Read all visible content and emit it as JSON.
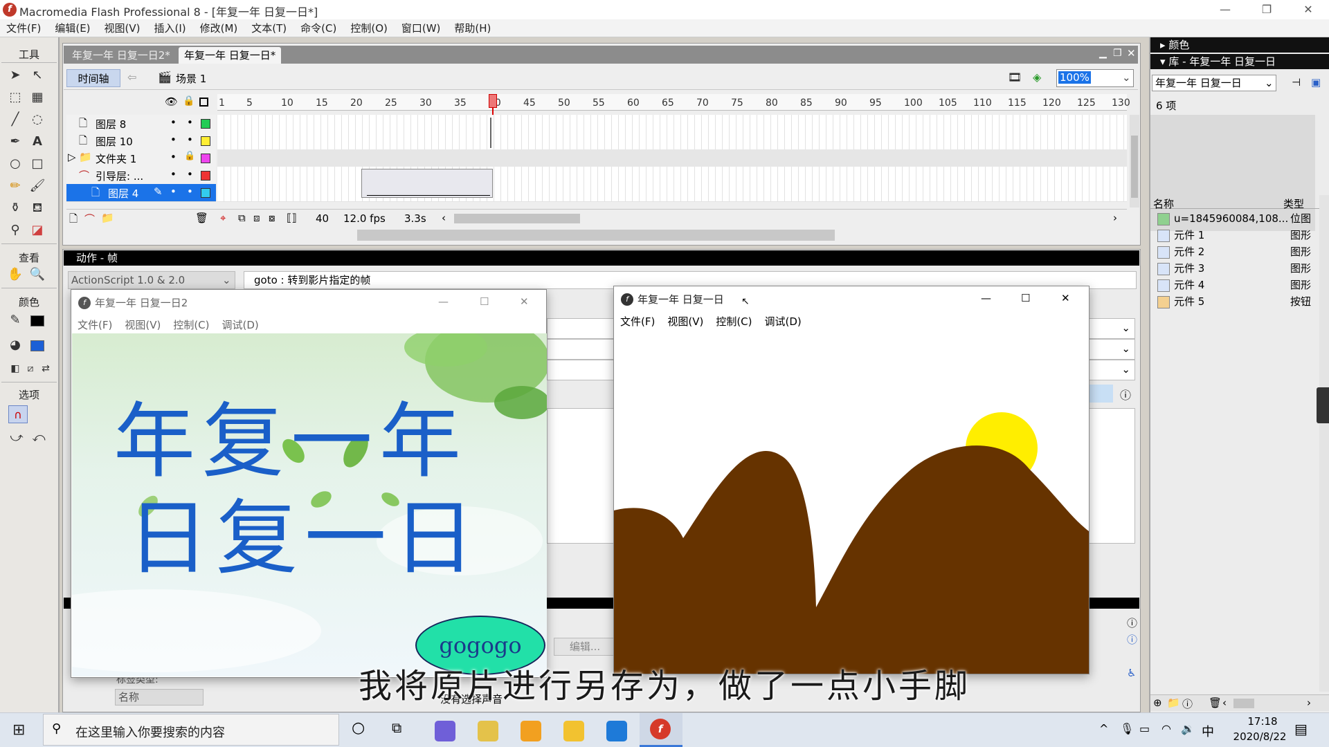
{
  "app": {
    "title": "Macromedia Flash Professional 8 - [年复一年  日复一日*]",
    "window_controls": {
      "minimize": "—",
      "maximize": "❐",
      "close": "✕"
    }
  },
  "menubar": [
    "文件(F)",
    "编辑(E)",
    "视图(V)",
    "插入(I)",
    "修改(M)",
    "文本(T)",
    "命令(C)",
    "控制(O)",
    "窗口(W)",
    "帮助(H)"
  ],
  "tools": {
    "header": "工具",
    "view_header": "查看",
    "color_header": "颜色",
    "options_header": "选项"
  },
  "doc_tabs": [
    "年复一年  日复一日2*",
    "年复一年  日复一日*"
  ],
  "timeline": {
    "button": "时间轴",
    "scene": "场景 1",
    "zoom": "100%",
    "ruler_ticks": [
      "1",
      "5",
      "10",
      "15",
      "20",
      "25",
      "30",
      "35",
      "40",
      "45",
      "50",
      "55",
      "60",
      "65",
      "70",
      "75",
      "80",
      "85",
      "90",
      "95",
      "100",
      "105",
      "110",
      "115",
      "120",
      "125",
      "130"
    ],
    "layers": [
      {
        "name": "图层 8",
        "color": "#22cc55"
      },
      {
        "name": "图层 10",
        "color": "#ffee33"
      },
      {
        "name": "文件夹 1",
        "color": "#ee44ee"
      },
      {
        "name": "引导层: ...",
        "color": "#ee3333"
      },
      {
        "name": "图层 4",
        "color": "#33ccee"
      }
    ],
    "current_frame": "40",
    "fps": "12.0 fps",
    "time": "3.3s"
  },
  "actions": {
    "header": "动作 - 帧",
    "version_select": "ActionScript 1.0 & 2.0",
    "hint": "goto : 转到影片指定的帧",
    "edit_button": "编辑...",
    "no_sound": "没有选择声音",
    "sound_type_label": "标签类型:",
    "sound_name_select": "名称"
  },
  "library": {
    "color_header": "颜色",
    "header": "库 - 年复一年  日复一日",
    "doc_select": "年复一年  日复一日",
    "count": "6 项",
    "col_name": "名称",
    "col_type": "类型",
    "items": [
      {
        "name": "u=1845960084,108...",
        "type": "位图"
      },
      {
        "name": "元件 1",
        "type": "图形"
      },
      {
        "name": "元件 2",
        "type": "图形"
      },
      {
        "name": "元件 3",
        "type": "图形"
      },
      {
        "name": "元件 4",
        "type": "图形"
      },
      {
        "name": "元件 5",
        "type": "按钮"
      }
    ]
  },
  "win1": {
    "title": "年复一年  日复一日2",
    "menu": [
      "文件(F)",
      "视图(V)",
      "控制(C)",
      "调试(D)"
    ],
    "art_line1": "年复一年",
    "art_line2": "日复一日",
    "button_label": "gogogo"
  },
  "win2": {
    "title": "年复一年  日复一日",
    "menu": [
      "文件(F)",
      "视图(V)",
      "控制(C)",
      "调试(D)"
    ]
  },
  "caption": "我将原片进行另存为，做了一点小手脚",
  "taskbar": {
    "search_placeholder": "在这里输入你要搜索的内容",
    "ime": "中",
    "time": "17:18",
    "date": "2020/8/22"
  },
  "colors": {
    "mountain": "#663300",
    "sun": "#ffee00",
    "button_fill": "#22e0a8",
    "calligraphy": "#1a5fc8",
    "selection": "#1b73e8"
  }
}
